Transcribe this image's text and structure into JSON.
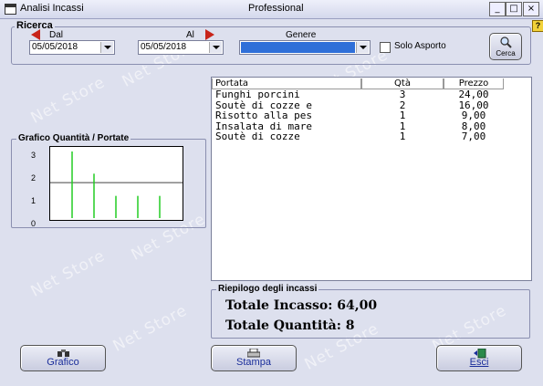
{
  "window": {
    "title": "Analisi Incassi",
    "subtitle": "Professional",
    "min_glyph": "_",
    "max_glyph": "□",
    "close_glyph": "×",
    "help_glyph": "?"
  },
  "watermark": "Net Store",
  "search": {
    "group_label": "Ricerca",
    "from_label": "Dal",
    "from_value": "05/05/2018",
    "to_label": "Al",
    "to_value": "05/05/2018",
    "genre_label": "Genere",
    "genre_value": "",
    "takeaway_label": "Solo Asporto",
    "takeaway_checked": false,
    "search_button": "Cerca"
  },
  "chart": {
    "group_label": "Grafico Quantità / Portate",
    "yticks": [
      "3",
      "2",
      "1",
      "0"
    ]
  },
  "chart_data": {
    "type": "bar",
    "categories": [
      "Funghi porcini",
      "Soutè di cozze e",
      "Risotto alla pes",
      "Insalata di mare",
      "Soutè di cozze"
    ],
    "values": [
      3,
      2,
      1,
      1,
      1
    ],
    "ylim": [
      0,
      3
    ],
    "average_line": 1.6,
    "bar_color": "#22cc22"
  },
  "table": {
    "columns": [
      "Portata",
      "Qtà",
      "Prezzo"
    ],
    "rows": [
      {
        "portata": "Funghi porcini",
        "qta": "3",
        "prezzo": "24,00"
      },
      {
        "portata": "Soutè di cozze e",
        "qta": "2",
        "prezzo": "16,00"
      },
      {
        "portata": "Risotto alla pes",
        "qta": "1",
        "prezzo": "9,00"
      },
      {
        "portata": "Insalata di mare",
        "qta": "1",
        "prezzo": "8,00"
      },
      {
        "portata": "Soutè di cozze",
        "qta": "1",
        "prezzo": "7,00"
      }
    ]
  },
  "summary": {
    "group_label": "Riepilogo degli incassi",
    "total_income": "Totale Incasso: 64,00",
    "total_quantity": "Totale Quantità: 8"
  },
  "buttons": {
    "chart": "Grafico",
    "print": "Stampa",
    "exit": "Esci"
  },
  "colors": {
    "arrow": "#c8241a",
    "genre_select": "#2f6fd8",
    "button_text": "#1a2d9a"
  }
}
